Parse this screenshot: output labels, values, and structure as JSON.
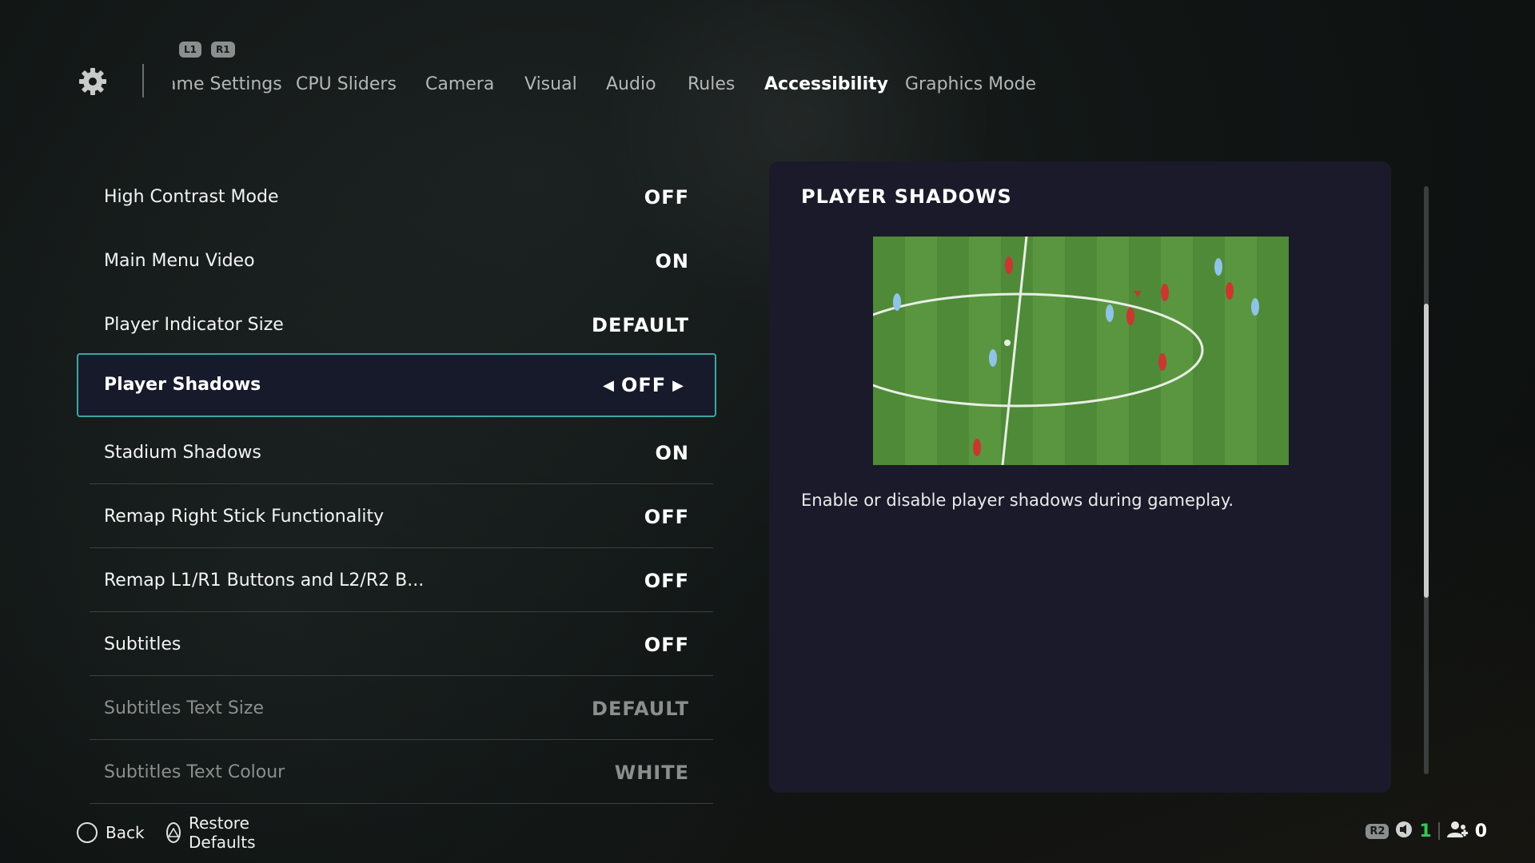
{
  "header": {
    "shoulder_left": "L1",
    "shoulder_right": "R1",
    "tabs": [
      {
        "label": "Game Settings"
      },
      {
        "label": "CPU Sliders"
      },
      {
        "label": "Camera"
      },
      {
        "label": "Visual"
      },
      {
        "label": "Audio"
      },
      {
        "label": "Rules"
      },
      {
        "label": "Accessibility",
        "active": true
      },
      {
        "label": "Graphics Mode"
      }
    ]
  },
  "settings": [
    {
      "label": "High Contrast Mode",
      "value": "OFF"
    },
    {
      "label": "Main Menu Video",
      "value": "ON"
    },
    {
      "label": "Player Indicator Size",
      "value": "DEFAULT"
    },
    {
      "label": "Player Shadows",
      "value": "OFF",
      "selected": true
    },
    {
      "label": "Stadium Shadows",
      "value": "ON"
    },
    {
      "label": "Remap Right Stick Functionality",
      "value": "OFF"
    },
    {
      "label": "Remap L1/R1 Buttons and L2/R2 B...",
      "value": "OFF"
    },
    {
      "label": "Subtitles",
      "value": "OFF"
    },
    {
      "label": "Subtitles Text Size",
      "value": "DEFAULT",
      "disabled": true
    },
    {
      "label": "Subtitles Text Colour",
      "value": "WHITE",
      "disabled": true
    }
  ],
  "detail": {
    "title": "PLAYER SHADOWS",
    "description": "Enable or disable player shadows during gameplay."
  },
  "scrollbar": {
    "position_fraction": 0.2,
    "visible_fraction": 0.5
  },
  "footer": {
    "back_label": "Back",
    "restore_label": "Restore Defaults"
  },
  "status": {
    "r2": "R2",
    "green_count": "1",
    "player_count": "0",
    "accent_green": "#35c759"
  },
  "colors": {
    "selection_border": "#3aa6a6",
    "panel_bg": "#1a1a2b"
  }
}
